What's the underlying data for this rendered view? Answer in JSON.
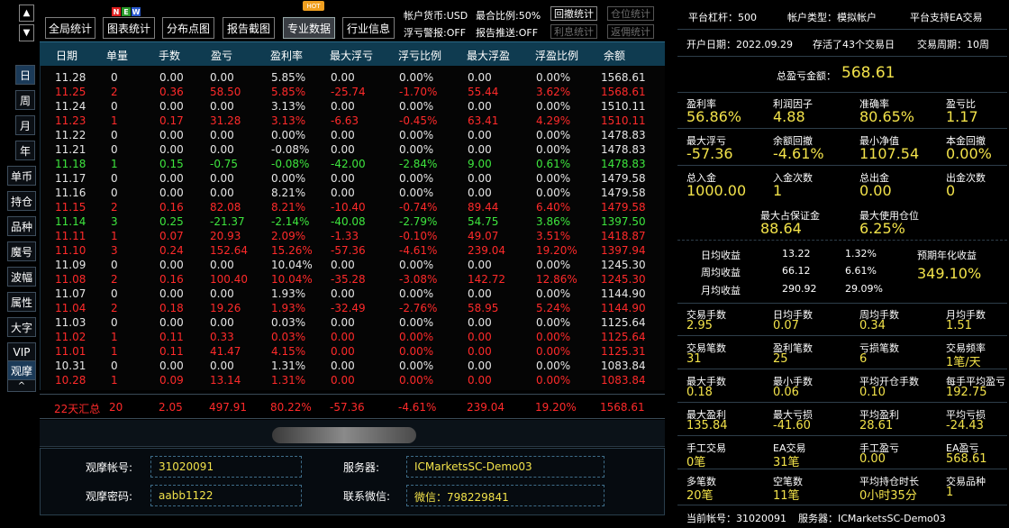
{
  "leftnav": {
    "up": "▲",
    "down": "▼",
    "items": [
      "日",
      "周",
      "月",
      "年",
      "单币",
      "持仓",
      "品种",
      "魔号",
      "波幅",
      "属性",
      "大字",
      "VIP",
      "观摩"
    ],
    "collapse": "^"
  },
  "toolbar": {
    "buttons": [
      "全局统计",
      "图表统计",
      "分布点图",
      "报告截图",
      "专业数据",
      "行业信息"
    ],
    "new_badge": [
      "N",
      "E",
      "W"
    ],
    "hot_badge": "HOT",
    "currency": "帐户货币:USD",
    "max_ratio": "最合比例:50%",
    "float_warn": "浮亏警报:OFF",
    "report_push": "报告推送:OFF",
    "btn_retract": "回撤统计",
    "btn_position": "仓位统计",
    "btn_interest": "利息统计",
    "btn_rebate": "返佣统计"
  },
  "table": {
    "headers": [
      "日期",
      "单量",
      "手数",
      "盈亏",
      "盈利率",
      "最大浮亏",
      "浮亏比例",
      "最大浮盈",
      "浮盈比例",
      "余额"
    ],
    "rows": [
      {
        "c": "white",
        "v": [
          "11.28",
          "0",
          "0.00",
          "0.00",
          "5.85%",
          "0.00",
          "0.00%",
          "0.00",
          "0.00%",
          "1568.61"
        ]
      },
      {
        "c": "red",
        "v": [
          "11.25",
          "2",
          "0.36",
          "58.50",
          "5.85%",
          "-25.74",
          "-1.70%",
          "55.44",
          "3.62%",
          "1568.61"
        ]
      },
      {
        "c": "white",
        "v": [
          "11.24",
          "0",
          "0.00",
          "0.00",
          "3.13%",
          "0.00",
          "0.00%",
          "0.00",
          "0.00%",
          "1510.11"
        ]
      },
      {
        "c": "red",
        "v": [
          "11.23",
          "1",
          "0.17",
          "31.28",
          "3.13%",
          "-6.63",
          "-0.45%",
          "63.41",
          "4.29%",
          "1510.11"
        ]
      },
      {
        "c": "white",
        "v": [
          "11.22",
          "0",
          "0.00",
          "0.00",
          "0.00%",
          "0.00",
          "0.00%",
          "0.00",
          "0.00%",
          "1478.83"
        ]
      },
      {
        "c": "white",
        "v": [
          "11.21",
          "0",
          "0.00",
          "0.00",
          "-0.08%",
          "0.00",
          "0.00%",
          "0.00",
          "0.00%",
          "1478.83"
        ]
      },
      {
        "c": "green",
        "v": [
          "11.18",
          "1",
          "0.15",
          "-0.75",
          "-0.08%",
          "-42.00",
          "-2.84%",
          "9.00",
          "0.61%",
          "1478.83"
        ]
      },
      {
        "c": "white",
        "v": [
          "11.17",
          "0",
          "0.00",
          "0.00",
          "0.00%",
          "0.00",
          "0.00%",
          "0.00",
          "0.00%",
          "1479.58"
        ]
      },
      {
        "c": "white",
        "v": [
          "11.16",
          "0",
          "0.00",
          "0.00",
          "8.21%",
          "0.00",
          "0.00%",
          "0.00",
          "0.00%",
          "1479.58"
        ]
      },
      {
        "c": "red",
        "v": [
          "11.15",
          "2",
          "0.16",
          "82.08",
          "8.21%",
          "-10.40",
          "-0.74%",
          "89.44",
          "6.40%",
          "1479.58"
        ]
      },
      {
        "c": "green",
        "v": [
          "11.14",
          "3",
          "0.25",
          "-21.37",
          "-2.14%",
          "-40.08",
          "-2.79%",
          "54.75",
          "3.86%",
          "1397.50"
        ]
      },
      {
        "c": "red",
        "v": [
          "11.11",
          "1",
          "0.07",
          "20.93",
          "2.09%",
          "-1.33",
          "-0.10%",
          "49.07",
          "3.51%",
          "1418.87"
        ]
      },
      {
        "c": "red",
        "v": [
          "11.10",
          "3",
          "0.24",
          "152.64",
          "15.26%",
          "-57.36",
          "-4.61%",
          "239.04",
          "19.20%",
          "1397.94"
        ]
      },
      {
        "c": "white",
        "v": [
          "11.09",
          "0",
          "0.00",
          "0.00",
          "10.04%",
          "0.00",
          "0.00%",
          "0.00",
          "0.00%",
          "1245.30"
        ]
      },
      {
        "c": "red",
        "v": [
          "11.08",
          "2",
          "0.16",
          "100.40",
          "10.04%",
          "-35.28",
          "-3.08%",
          "142.72",
          "12.86%",
          "1245.30"
        ]
      },
      {
        "c": "white",
        "v": [
          "11.07",
          "0",
          "0.00",
          "0.00",
          "1.93%",
          "0.00",
          "0.00%",
          "0.00",
          "0.00%",
          "1144.90"
        ]
      },
      {
        "c": "red",
        "v": [
          "11.04",
          "2",
          "0.18",
          "19.26",
          "1.93%",
          "-32.49",
          "-2.76%",
          "58.95",
          "5.24%",
          "1144.90"
        ]
      },
      {
        "c": "white",
        "v": [
          "11.03",
          "0",
          "0.00",
          "0.00",
          "0.03%",
          "0.00",
          "0.00%",
          "0.00",
          "0.00%",
          "1125.64"
        ]
      },
      {
        "c": "red",
        "v": [
          "11.02",
          "1",
          "0.11",
          "0.33",
          "0.03%",
          "0.00",
          "0.00%",
          "0.00",
          "0.00%",
          "1125.64"
        ]
      },
      {
        "c": "red",
        "v": [
          "11.01",
          "1",
          "0.11",
          "41.47",
          "4.15%",
          "0.00",
          "0.00%",
          "0.00",
          "0.00%",
          "1125.31"
        ]
      },
      {
        "c": "white",
        "v": [
          "10.31",
          "0",
          "0.00",
          "0.00",
          "1.31%",
          "0.00",
          "0.00%",
          "0.00",
          "0.00%",
          "1083.84"
        ]
      },
      {
        "c": "red",
        "v": [
          "10.28",
          "1",
          "0.09",
          "13.14",
          "1.31%",
          "0.00",
          "0.00%",
          "0.00",
          "0.00%",
          "1083.84"
        ]
      }
    ],
    "summary": [
      "22天汇总",
      "20",
      "2.05",
      "497.91",
      "80.22%",
      "-57.36",
      "-4.61%",
      "239.04",
      "19.20%",
      "1568.61"
    ]
  },
  "form": {
    "account_label": "观摩帐号:",
    "account_value": "31020091",
    "server_label": "服务器:",
    "server_value": "ICMarketsSC-Demo03",
    "password_label": "观摩密码:",
    "password_value": "aabb1122",
    "wechat_label": "联系微信:",
    "wechat_value": "微信：798229841"
  },
  "right": {
    "leverage": "平台杠杆：500",
    "account_type": "帐户类型：模拟帐户",
    "ea_support": "平台支持EA交易",
    "open_date": "开户日期：2022.09.29",
    "days_survived": "存活了43个交易日",
    "trade_period": "交易周期：10周",
    "total_pl_label": "总盈亏金额：",
    "total_pl_value": "568.61",
    "grid1": [
      {
        "label": "盈利率",
        "value": "56.86%"
      },
      {
        "label": "利润因子",
        "value": "4.88"
      },
      {
        "label": "准确率",
        "value": "80.65%"
      },
      {
        "label": "盈亏比",
        "value": "1.17"
      },
      {
        "label": "最大浮亏",
        "value": "-57.36"
      },
      {
        "label": "余额回撤",
        "value": "-4.61%"
      },
      {
        "label": "最小净值",
        "value": "1107.54"
      },
      {
        "label": "本金回撤",
        "value": "0.00%"
      },
      {
        "label": "总入金",
        "value": "1000.00"
      },
      {
        "label": "入金次数",
        "value": "1"
      },
      {
        "label": "总出金",
        "value": "0.00"
      },
      {
        "label": "出金次数",
        "value": "0"
      }
    ],
    "margin_label": "最大占保证金",
    "margin_value": "88.64",
    "max_pos_label": "最大使用仓位",
    "max_pos_value": "6.25%",
    "avg": [
      {
        "label": "日均收益",
        "amount": "13.22",
        "pct": "1.32%"
      },
      {
        "label": "周均收益",
        "amount": "66.12",
        "pct": "6.61%"
      },
      {
        "label": "月均收益",
        "amount": "290.92",
        "pct": "29.09%"
      }
    ],
    "annual_label": "预期年化收益",
    "annual_value": "349.10%",
    "grid2": [
      {
        "label": "交易手数",
        "value": "2.95"
      },
      {
        "label": "日均手数",
        "value": "0.07"
      },
      {
        "label": "周均手数",
        "value": "0.34"
      },
      {
        "label": "月均手数",
        "value": "1.51"
      },
      {
        "label": "交易笔数",
        "value": "31"
      },
      {
        "label": "盈利笔数",
        "value": "25"
      },
      {
        "label": "亏损笔数",
        "value": "6"
      },
      {
        "label": "交易频率",
        "value": "1笔/天"
      },
      {
        "label": "最大手数",
        "value": "0.18"
      },
      {
        "label": "最小手数",
        "value": "0.06"
      },
      {
        "label": "平均开仓手数",
        "value": "0.10"
      },
      {
        "label": "每手平均盈亏",
        "value": "192.75"
      },
      {
        "label": "最大盈利",
        "value": "135.84"
      },
      {
        "label": "最大亏损",
        "value": "-41.60"
      },
      {
        "label": "平均盈利",
        "value": "28.61"
      },
      {
        "label": "平均亏损",
        "value": "-24.43"
      },
      {
        "label": "手工交易",
        "value": "0笔"
      },
      {
        "label": "EA交易",
        "value": "31笔"
      },
      {
        "label": "手工盈亏",
        "value": "0.00"
      },
      {
        "label": "EA盈亏",
        "value": "568.61"
      },
      {
        "label": "多笔数",
        "value": "20笔"
      },
      {
        "label": "空笔数",
        "value": "11笔"
      },
      {
        "label": "平均持仓时长",
        "value": "0小时35分"
      },
      {
        "label": "交易品种",
        "value": "1"
      }
    ],
    "current_account": "当前帐号：31020091",
    "server": "服务器：ICMarketsSC-Demo03"
  },
  "colors": {
    "red": "#ff2a2a",
    "green": "#3ee63e",
    "yellow": "#f2e24a",
    "header_bg": "#0f3b50"
  }
}
